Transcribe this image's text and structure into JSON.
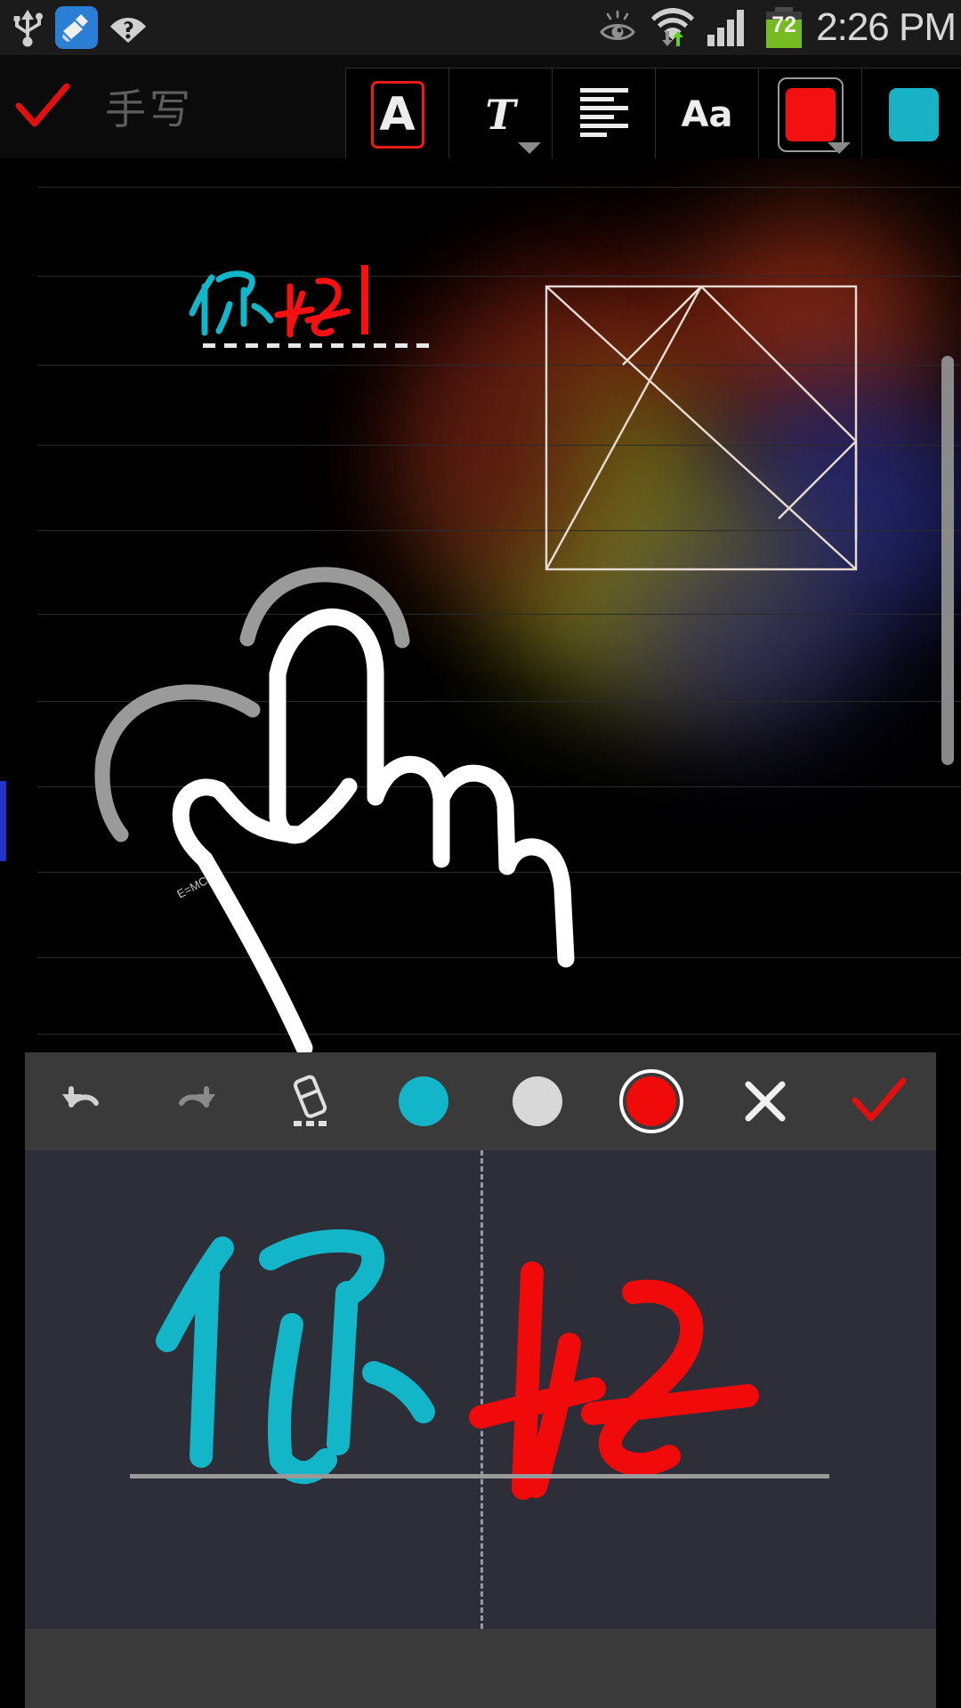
{
  "status_bar": {
    "time": "2:26 PM",
    "battery_percent": "72",
    "left_icons": [
      {
        "name": "usb-icon",
        "label": "USB"
      },
      {
        "name": "cleaner-app-icon",
        "label": "Cleaner"
      },
      {
        "name": "wifi-question-icon",
        "label": "WiFi unknown network"
      }
    ],
    "right_icons": [
      {
        "name": "smart-stay-eye-icon",
        "label": "Smart stay"
      },
      {
        "name": "wifi-transfer-icon",
        "label": "WiFi data transfer"
      },
      {
        "name": "signal-bars-icon",
        "label": "Signal"
      },
      {
        "name": "battery-icon",
        "label": "Battery"
      }
    ]
  },
  "top_bar": {
    "confirm_label": "✓",
    "confirm_icon": "check-icon",
    "title": "手写",
    "tools": [
      {
        "name": "text-style-button",
        "glyph": "A",
        "selected": true,
        "has_dropdown": false
      },
      {
        "name": "text-format-button",
        "glyph": "T",
        "selected": false,
        "has_dropdown": true
      },
      {
        "name": "align-button",
        "glyph": "align-left-icon",
        "selected": false,
        "has_dropdown": false
      },
      {
        "name": "font-size-button",
        "glyph": "Aa",
        "selected": false,
        "has_dropdown": false
      },
      {
        "name": "pen-color-button",
        "glyph": "color-swatch",
        "color": "#f21010",
        "selected": true,
        "has_dropdown": true
      },
      {
        "name": "secondary-color-button",
        "glyph": "color-swatch",
        "color": "#18b2c4",
        "selected": false,
        "has_dropdown": false
      }
    ],
    "collapse_icon": "chevron-down-icon"
  },
  "canvas": {
    "note_text_cyan": "你",
    "note_text_red": "好",
    "annotation_label": "E=MC",
    "shape_name": "tangram-square",
    "ruled_line_count": 11,
    "colors": {
      "ink_cyan": "#13b5c9",
      "ink_red": "#f51111",
      "ink_white": "#ffffff",
      "ink_gray": "#9a9a9a",
      "rule_line": "#2a2a2a",
      "margin_bar": "#2233cc"
    }
  },
  "handwriting_panel": {
    "tools": [
      {
        "name": "undo-button",
        "icon": "undo-icon"
      },
      {
        "name": "redo-button",
        "icon": "redo-icon"
      },
      {
        "name": "eraser-button",
        "icon": "eraser-icon"
      },
      {
        "name": "color-cyan-button",
        "icon": "color-dot",
        "color": "#13b5c9",
        "selected": false
      },
      {
        "name": "color-white-button",
        "icon": "color-dot",
        "color": "#d8d8d8",
        "selected": false
      },
      {
        "name": "color-red-button",
        "icon": "color-dot",
        "color": "#f00a0a",
        "selected": true
      },
      {
        "name": "cancel-button",
        "icon": "close-icon"
      },
      {
        "name": "confirm-button",
        "icon": "check-icon"
      }
    ],
    "stroke_cyan_char": "你",
    "stroke_red_char": "好",
    "divider_style": "dashed"
  }
}
